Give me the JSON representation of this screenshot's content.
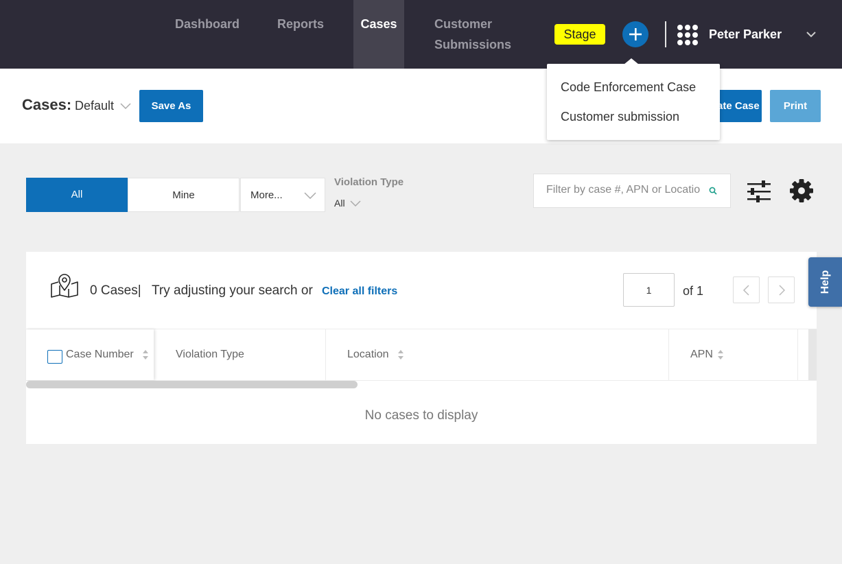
{
  "nav": {
    "items": [
      {
        "label": "Dashboard"
      },
      {
        "label": "Reports"
      },
      {
        "label": "Cases"
      },
      {
        "label": "Customer Submissions"
      }
    ],
    "env_badge": "Stage",
    "user_name": "Peter Parker"
  },
  "header": {
    "title": "Cases:",
    "view": "Default",
    "save_as_label": "Save As",
    "create_case_label": "Create Case",
    "print_label": "Print"
  },
  "create_menu": {
    "items": [
      "Code Enforcement Case",
      "Customer submission"
    ]
  },
  "filters": {
    "tabs": [
      "All",
      "Mine",
      "More..."
    ],
    "violation_type_label": "Violation Type",
    "violation_type_value": "All",
    "search_placeholder": "Filter by case #, APN or Location"
  },
  "results": {
    "count_text": "0 Cases|",
    "hint": "Try adjusting your search or",
    "clear_label": "Clear all filters",
    "page": "1",
    "page_of": "of 1",
    "empty_message": "No cases to display"
  },
  "table": {
    "columns": [
      "Case Number",
      "Violation Type",
      "Location",
      "APN"
    ]
  },
  "help_label": "Help",
  "colors": {
    "nav_bg": "#2d2b38",
    "primary": "#0e6fb8",
    "badge": "#ffff00",
    "help_tab": "#3f6fa8"
  }
}
